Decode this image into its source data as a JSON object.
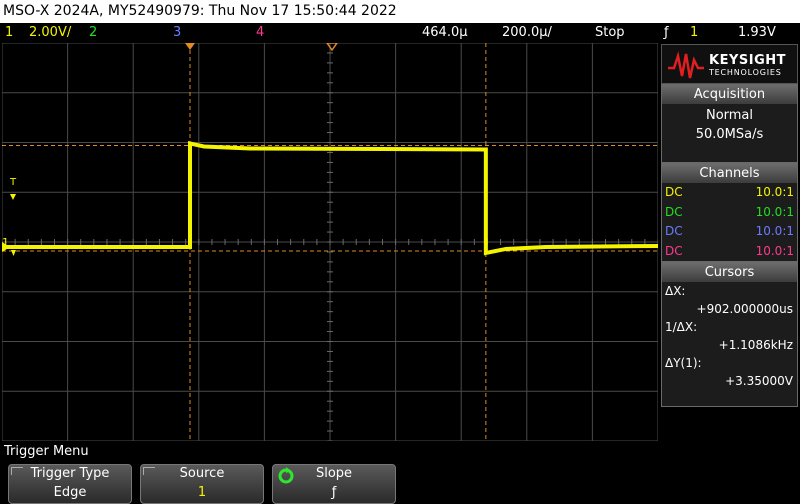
{
  "window_title": "MSO-X 2024A, MY52490979: Thu Nov 17 15:50:44 2022",
  "status": {
    "ch1_num": "1",
    "ch1_scale": "2.00V/",
    "ch2_num": "2",
    "ch3_num": "3",
    "ch4_num": "4",
    "time_delay": "464.0µ",
    "time_scale": "200.0µ/",
    "run_state": "Stop",
    "trigger_slope_symbol": "ƒ",
    "trigger_source": "1",
    "trigger_level": "1.93V"
  },
  "screen_markers": {
    "trigger_level_marker": "T",
    "ch1_ground_marker": "1"
  },
  "colors": {
    "ch1": "#f4f400",
    "ch2": "#20e020",
    "ch3": "#6a7cff",
    "ch4": "#ff3a8c",
    "cursor": "#e08a28",
    "grid": "#4a4a4a"
  },
  "logo": {
    "brand": "KEYSIGHT",
    "subtitle": "TECHNOLOGIES"
  },
  "acquisition": {
    "title": "Acquisition",
    "mode": "Normal",
    "rate": "50.0MSa/s"
  },
  "channels": {
    "title": "Channels",
    "rows": [
      {
        "coupling": "DC",
        "probe": "10.0:1"
      },
      {
        "coupling": "DC",
        "probe": "10.0:1"
      },
      {
        "coupling": "DC",
        "probe": "10.0:1"
      },
      {
        "coupling": "DC",
        "probe": "10.0:1"
      }
    ]
  },
  "cursors": {
    "title": "Cursors",
    "dx_label": "ΔX:",
    "dx_value": "+902.000000us",
    "inv_dx_label": "1/ΔX:",
    "inv_dx_value": "+1.1086kHz",
    "dy_label": "ΔY(1):",
    "dy_value": "+3.35000V"
  },
  "menu": {
    "title": "Trigger Menu",
    "softkeys": [
      {
        "label": "Trigger Type",
        "value": "Edge"
      },
      {
        "label": "Source",
        "value": "1"
      },
      {
        "label": "Slope",
        "value": "ƒ"
      }
    ]
  },
  "waveform": {
    "low_level_divs": -0.1,
    "high_level_divs": 1.9,
    "rise_time_us": 0,
    "fall_time_us": 902,
    "time_per_div_us": 200,
    "volts_per_div": 2.0
  }
}
